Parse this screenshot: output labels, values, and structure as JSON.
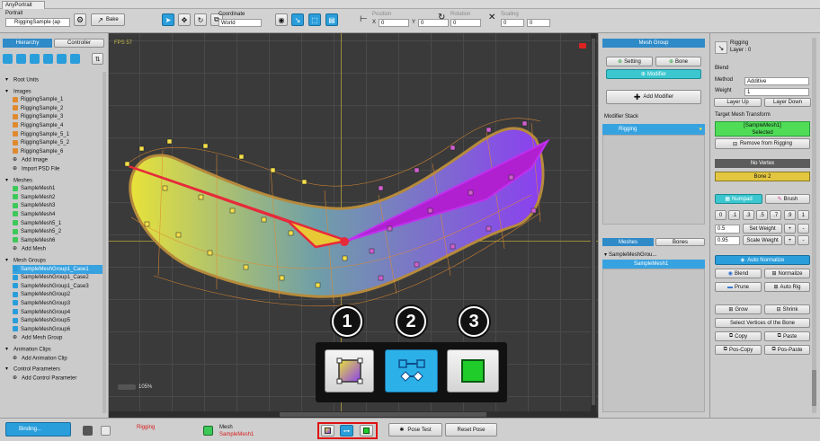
{
  "window": {
    "title": "AnyPortrait"
  },
  "toolbar": {
    "portrait_label": "Portrait",
    "portrait_value": "RiggingSample (ap",
    "bake": "Bake",
    "coordinate_label": "Coordinate",
    "coordinate_value": "World",
    "position_label": "Position",
    "position_x": "0",
    "position_y": "0",
    "rotation_label": "Rotation",
    "rotation_value": "0",
    "scaling_label": "Scaling",
    "scaling_x": "0",
    "scaling_y": "0",
    "x": "X",
    "y": "Y"
  },
  "left": {
    "tab_hierarchy": "Hierarchy",
    "tab_controller": "Controller",
    "root_units": "Root Units",
    "images_header": "Images",
    "images": [
      "RiggingSample_1",
      "RiggingSample_2",
      "RiggingSample_3",
      "RiggingSample_4",
      "RiggingSample_5_1",
      "RiggingSample_5_2",
      "RiggingSample_6"
    ],
    "add_image": "Add Image",
    "import_psd": "Import PSD File",
    "meshes_header": "Meshes",
    "meshes": [
      "SampleMesh1",
      "SampleMesh2",
      "SampleMesh3",
      "SampleMesh4",
      "SampleMesh5_1",
      "SampleMesh5_2",
      "SampleMesh6"
    ],
    "add_mesh": "Add Mesh",
    "mesh_groups_header": "Mesh Groups",
    "mesh_groups": [
      "SampleMeshGroup1_Case1",
      "SampleMeshGroup1_Case2",
      "SampleMeshGroup1_Case3",
      "SampleMeshGroup2",
      "SampleMeshGroup3",
      "SampleMeshGroup4",
      "SampleMeshGroup5",
      "SampleMeshGroup6"
    ],
    "add_mesh_group": "Add Mesh Group",
    "anim_header": "Animation Clips",
    "add_anim": "Add Animation Clip",
    "params_header": "Control Parameters",
    "add_param": "Add Control Parameter"
  },
  "viewport": {
    "fps": "FPS 57",
    "zoom": "105%"
  },
  "callouts": [
    "1",
    "2",
    "3"
  ],
  "mesh_group_panel": {
    "title": "Mesh Group",
    "setting": "Setting",
    "bone": "Bone",
    "modifier": "Modifier",
    "add_modifier": "Add Modifier",
    "stack_label": "Modifier Stack",
    "stack_item": "Rigging",
    "tab_meshes": "Meshes",
    "tab_bones": "Bones",
    "tree_group": "SampleMeshGrou...",
    "tree_mesh": "SampleMesh1"
  },
  "right": {
    "title": "Rigging",
    "layer": "Layer : 0",
    "blend": "Blend",
    "method_label": "Method",
    "method_value": "Additive",
    "weight_label": "Weight",
    "weight_value": "1",
    "layer_up": "Layer Up",
    "layer_down": "Layer Down",
    "target_label": "Target Mesh Transform",
    "target_name": "[SampleMesh1]",
    "target_state": "Selected",
    "remove_rigging": "Remove from Rigging",
    "no_vertex": "No Vertex",
    "bone2": "Bone 2",
    "numpad": "Numpad",
    "brush": "Brush",
    "nums": [
      "0",
      ".1",
      ".3",
      ".5",
      ".7",
      ".9",
      "1"
    ],
    "set_value": "0.5",
    "set_weight": "Set Weight",
    "scale_value": "0.95",
    "scale_weight": "Scale Weight",
    "plus": "+",
    "minus": "-",
    "auto_normalize": "Auto Normalize",
    "blend_btn": "Blend",
    "normalize": "Normalize",
    "prune": "Prune",
    "auto_rig": "Auto Rig",
    "grow": "Grow",
    "shrink": "Shrink",
    "select_bone": "Select Vertices of the Bone",
    "copy": "Copy",
    "paste": "Paste",
    "pos_copy": "Pos-Copy",
    "pos_paste": "Pos-Paste"
  },
  "bottom": {
    "binding": "Binding...",
    "rigging": "Rigging",
    "mesh_label": "Mesh",
    "mesh_value": "SampleMesh1",
    "pose_test": "Pose Test",
    "reset_pose": "Reset Pose"
  }
}
